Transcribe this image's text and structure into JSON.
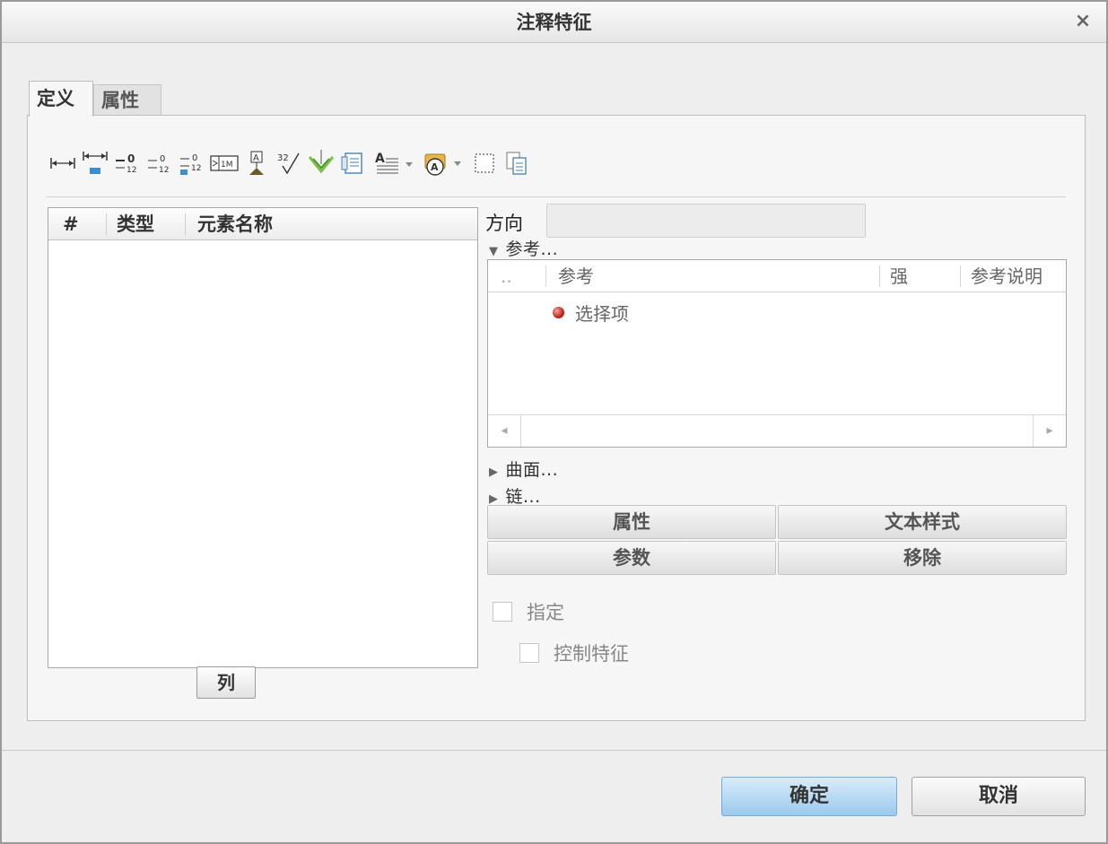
{
  "window": {
    "title": "注释特征",
    "close_glyph": "×"
  },
  "tabs": [
    {
      "label": "定义",
      "active": true
    },
    {
      "label": "属性",
      "active": false
    }
  ],
  "toolbar": {
    "icons": [
      "linear-dimension-icon",
      "ordinate-dimension-icon",
      "tolerance-stacked-icon",
      "tolerance-plusminus-icon",
      "tolerance-limits-icon",
      "gtol-frame-icon",
      "datum-target-icon",
      "surface-finish-icon",
      "symbol-icon",
      "note-icon",
      "text-style-icon",
      "palette-icon",
      "selection-box-icon",
      "copy-icon"
    ],
    "surface_finish_text": "32",
    "gtol_text": "1M",
    "datum_text": "A"
  },
  "element_list": {
    "headers": [
      "#",
      "类型",
      "元素名称"
    ],
    "rows": [],
    "columns_button": "列"
  },
  "direction": {
    "label": "方向",
    "value": ""
  },
  "references": {
    "section_label": "参考...",
    "expanded": true,
    "headers": [
      "..",
      "参考",
      "强",
      "参考说明"
    ],
    "items": [
      "选择项"
    ],
    "status_color": "#c0261b"
  },
  "surfaces": {
    "section_label": "曲面...",
    "expanded": false
  },
  "chain": {
    "section_label": "链...",
    "expanded": false
  },
  "action_buttons": {
    "properties": "属性",
    "text_style": "文本样式",
    "parameters": "参数",
    "remove": "移除"
  },
  "options": {
    "specify": {
      "label": "指定",
      "checked": false
    },
    "control_feature": {
      "label": "控制特征",
      "checked": false
    }
  },
  "footer": {
    "ok_label": "确定",
    "cancel_label": "取消",
    "ok_color": "#9cc9ec"
  }
}
